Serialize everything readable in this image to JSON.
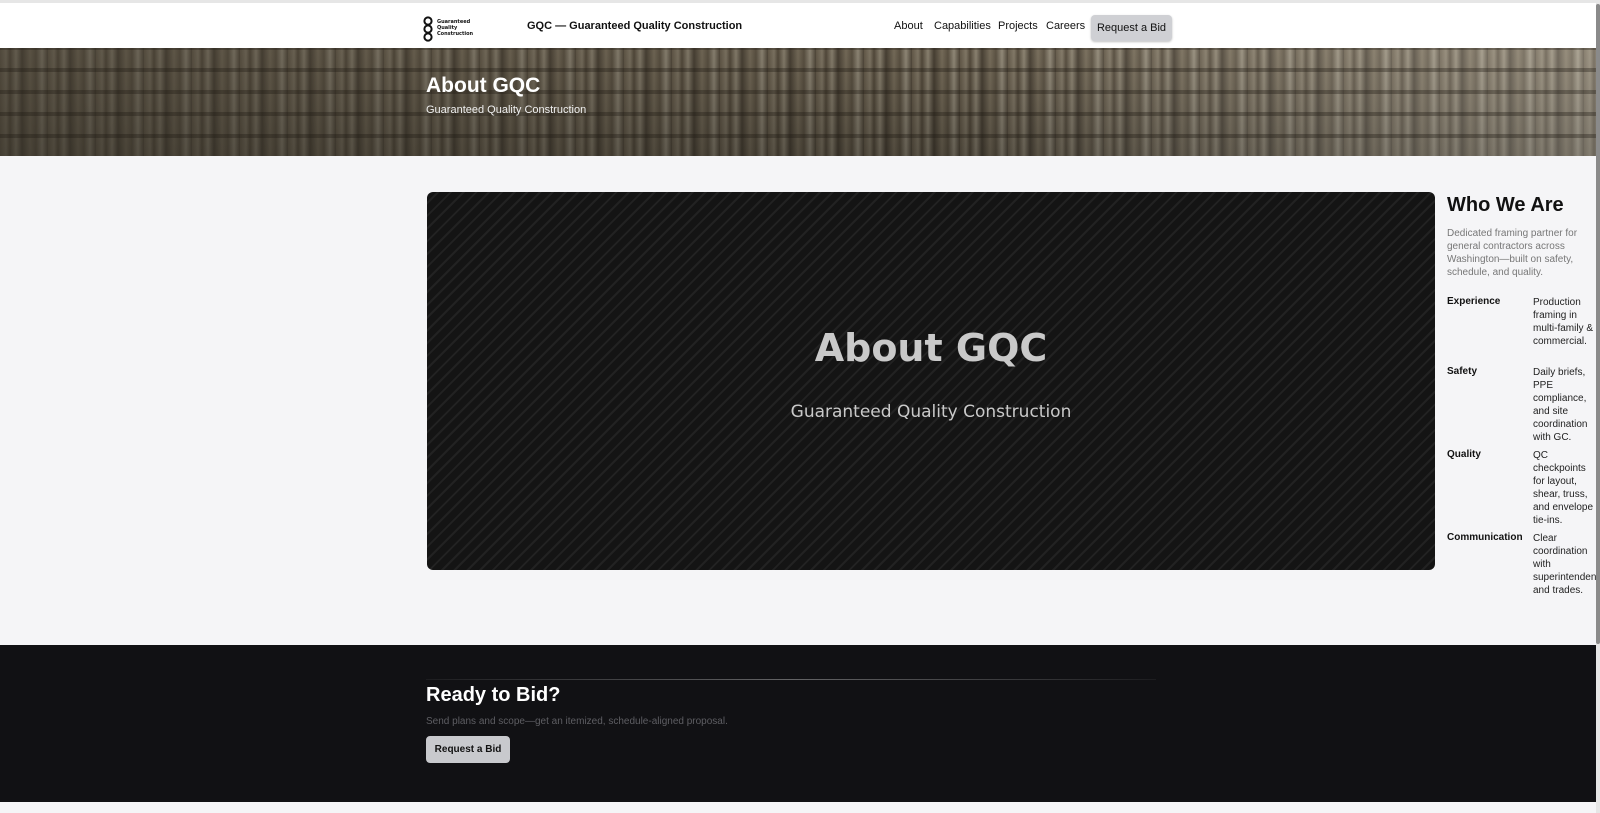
{
  "header": {
    "logo_text": [
      "Guaranteed",
      "Quality",
      "Construction"
    ],
    "site_title": "GQC — Guaranteed Quality Construction",
    "nav": [
      "About",
      "Capabilities",
      "Projects",
      "Careers"
    ],
    "cta_label": "Request a Bid"
  },
  "hero": {
    "title": "About GQC",
    "subtitle": "Guaranteed Quality Construction"
  },
  "card": {
    "title": "About GQC",
    "subtitle": "Guaranteed Quality Construction"
  },
  "aside": {
    "title": "Who We Are",
    "intro": "Dedicated framing partner for general contractors across Washington—built on safety, schedule, and quality.",
    "facts": [
      {
        "label": "Experience",
        "value": "Production framing in multi-family & commercial."
      },
      {
        "label": "Safety",
        "value": "Daily briefs, PPE compliance, and site coordination with GC."
      },
      {
        "label": "Quality",
        "value": "QC checkpoints for layout, shear, truss, and envelope tie-ins."
      },
      {
        "label": "Communication",
        "value": "Clear coordination with superintendents and trades."
      }
    ]
  },
  "footer_cta": {
    "title": "Ready to Bid?",
    "subtitle": "Send plans and scope—get an itemized, schedule-aligned proposal.",
    "button_label": "Request a Bid"
  },
  "colors": {
    "accent_button": "#cfd0d4",
    "dark": "#111114",
    "page_bg": "#f5f5f7"
  }
}
